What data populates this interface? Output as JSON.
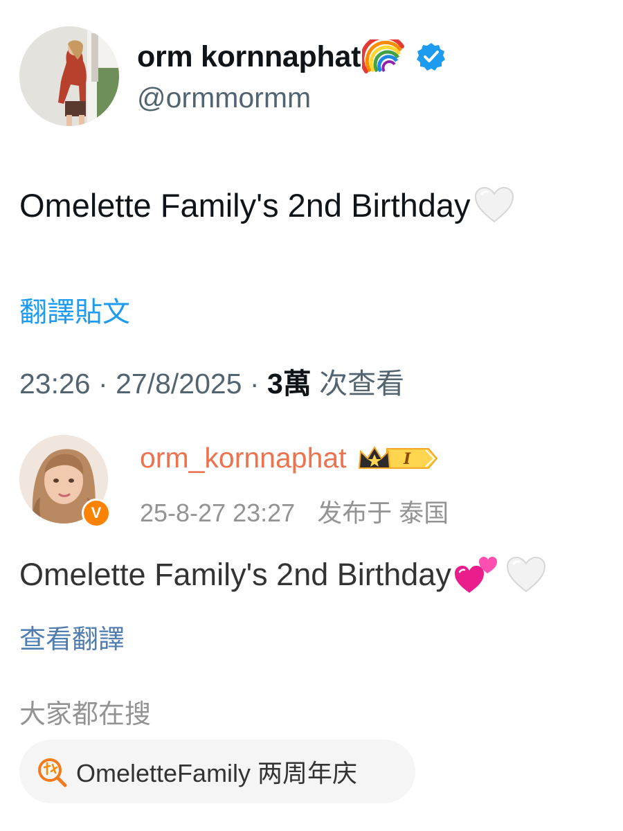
{
  "twitter_post": {
    "avatar_icon": "profile-photo",
    "display_name": "orm kornnaphat",
    "name_emoji": "rainbow-icon",
    "verified_icon": "verified-badge-icon",
    "handle": "@ormmormm",
    "text": "Omelette Family's 2nd Birthday",
    "text_emoji": "white-heart-icon",
    "translate_label": "翻譯貼文",
    "meta": {
      "time": "23:26",
      "separator": "·",
      "date": "27/8/2025",
      "views_count": "3萬",
      "views_label": "次查看"
    }
  },
  "weibo_post": {
    "avatar_icon": "profile-photo",
    "verified_badge": "V",
    "username": "orm_kornnaphat",
    "member_badge_icon": "crown-level-badge-icon",
    "member_badge_level": "I",
    "timestamp": "25-8-27 23:27",
    "location": "发布于 泰国",
    "text": "Omelette Family's 2nd Birthday",
    "text_emojis": [
      "two-hearts-icon",
      "white-heart-icon"
    ],
    "translate_label": "查看翻譯",
    "search_section_label": "大家都在搜",
    "hot_search": {
      "icon": "hot-search-icon",
      "query": "OmeletteFamily 两周年庆"
    }
  },
  "colors": {
    "twitter_blue": "#1d9bf0",
    "twitter_gray": "#536471",
    "weibo_orange_name": "#eb7350",
    "weibo_link": "#507daf",
    "weibo_gray": "#939393"
  }
}
